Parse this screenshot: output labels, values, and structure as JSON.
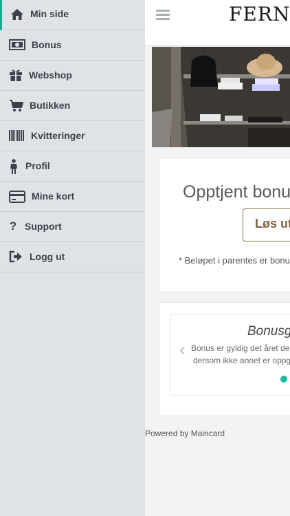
{
  "sidebar": {
    "items": [
      {
        "label": "Min side",
        "icon": "home-icon"
      },
      {
        "label": "Bonus",
        "icon": "banknote-icon"
      },
      {
        "label": "Webshop",
        "icon": "gift-icon"
      },
      {
        "label": "Butikken",
        "icon": "shopping-cart-icon"
      },
      {
        "label": "Kvitteringer",
        "icon": "barcode-icon"
      },
      {
        "label": "Profil",
        "icon": "person-icon"
      },
      {
        "label": "Mine kort",
        "icon": "credit-card-icon"
      },
      {
        "label": "Support",
        "icon": "question-icon"
      },
      {
        "label": "Logg ut",
        "icon": "sign-out-icon"
      }
    ]
  },
  "header": {
    "brand": "FERNER"
  },
  "bonus_card": {
    "earned_label": "Opptjent bonus",
    "redeem_button": "Løs ut",
    "note": "* Beløpet i parentes er bonus"
  },
  "info_card": {
    "title": "Bonusgrense",
    "line1": "Bonus er gyldig det året den",
    "line2": "dersom ikke annet er oppgitt"
  },
  "footer": {
    "text": "Powered by Maincard"
  },
  "colors": {
    "accent": "#1aa98a",
    "brand_gold": "#7d6440",
    "sidebar_bg": "#dfe3e8"
  }
}
